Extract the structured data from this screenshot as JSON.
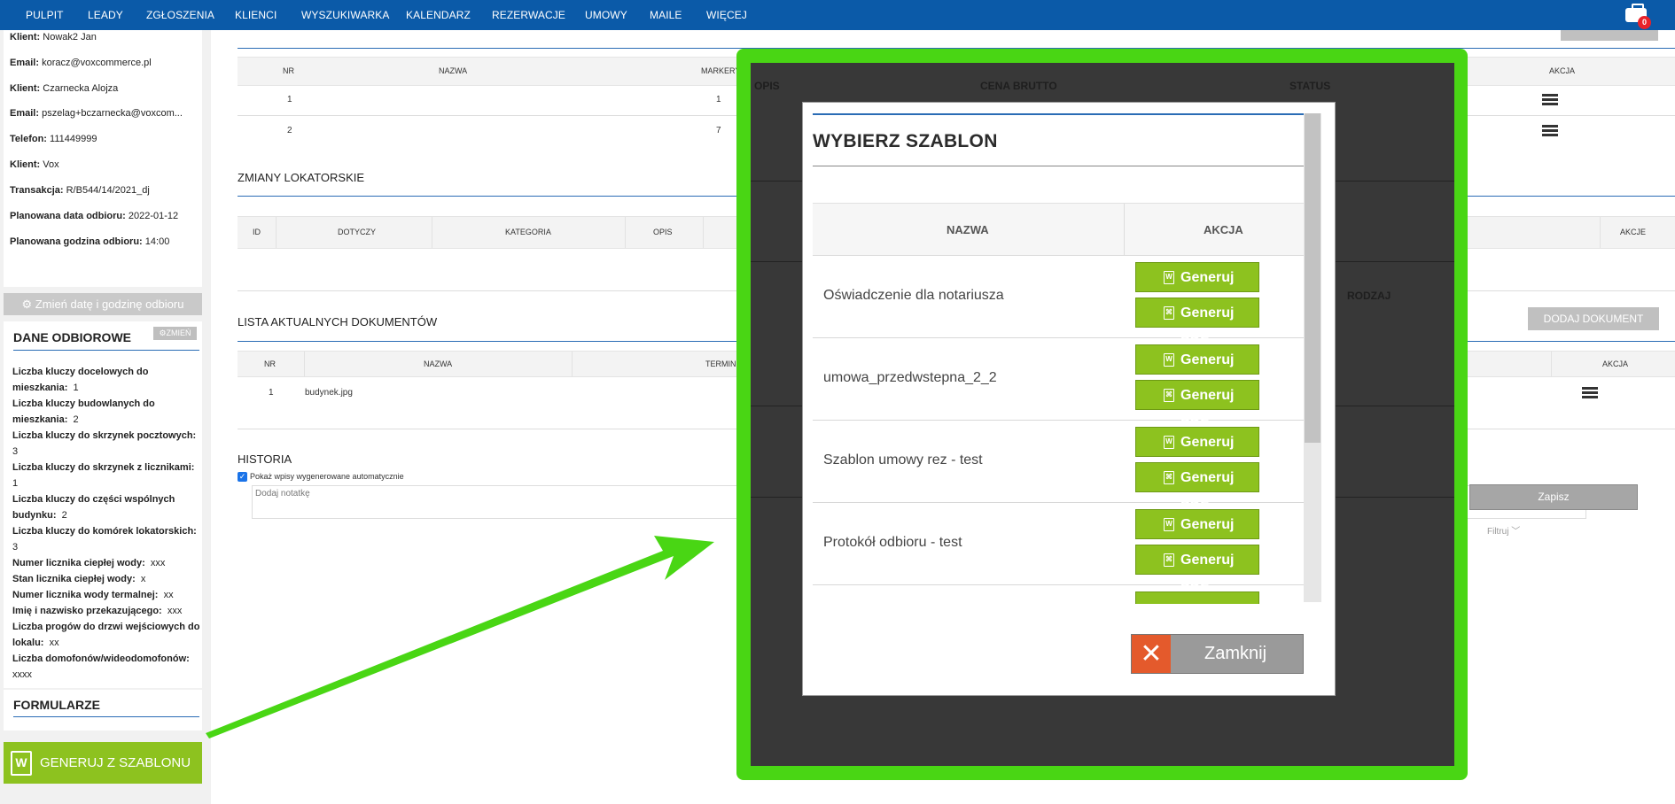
{
  "nav": {
    "items": [
      "PULPIT",
      "LEADY",
      "ZGŁOSZENIA",
      "KLIENCI",
      "WYSZUKIWARKA",
      "KALENDARZ",
      "REZERWACJE",
      "UMOWY",
      "MAILE",
      "WIĘCEJ"
    ],
    "badge": "0"
  },
  "client_info": [
    {
      "label": "Klient:",
      "value": "Nowak2 Jan"
    },
    {
      "label": "Email:",
      "value": "koracz@voxcommerce.pl"
    },
    {
      "label": "Klient:",
      "value": "Czarnecka Alojza"
    },
    {
      "label": "Email:",
      "value": "pszelag+bczarnecka@voxcom..."
    },
    {
      "label": "Telefon:",
      "value": "111449999"
    },
    {
      "label": "Klient:",
      "value": "Vox"
    },
    {
      "label": "Transakcja:",
      "value": "R/B544/14/2021_dj"
    },
    {
      "label": "Planowana data odbioru:",
      "value": "2022-01-12"
    },
    {
      "label": "Planowana godzina odbioru:",
      "value": "14:00"
    }
  ],
  "change_date_button": "Zmień datę i godzinę odbioru",
  "dane": {
    "title": "DANE ODBIOROWE",
    "edit": "ZMIEŃ",
    "rows": [
      {
        "label": "Liczba kluczy docelowych do mieszkania:",
        "value": "1"
      },
      {
        "label": "Liczba kluczy budowlanych do mieszkania:",
        "value": "2"
      },
      {
        "label": "Liczba kluczy do skrzynek pocztowych:",
        "value": "3"
      },
      {
        "label": "Liczba kluczy do skrzynek z licznikami:",
        "value": "1"
      },
      {
        "label": "Liczba kluczy do części wspólnych budynku:",
        "value": "2"
      },
      {
        "label": "Liczba kluczy do komórek lokatorskich:",
        "value": "3"
      },
      {
        "label": "Numer licznika ciepłej wody:",
        "value": "xxx"
      },
      {
        "label": "Stan licznika ciepłej wody:",
        "value": "x"
      },
      {
        "label": "Numer licznika wody termalnej:",
        "value": "xx"
      },
      {
        "label": "Imię i nazwisko przekazującego:",
        "value": "xxx"
      },
      {
        "label": "Liczba progów do drzwi wejściowych do lokalu:",
        "value": "xx"
      },
      {
        "label": "Liczba domofonów/wideodomofonów:",
        "value": "xxxx"
      }
    ]
  },
  "formularze_title": "FORMULARZE",
  "generate_button": "GENERUJ Z SZABLONU",
  "table1": {
    "headers": [
      "NR",
      "NAZWA",
      "MARKERY",
      "AKCJA"
    ],
    "rows": [
      {
        "nr": "1",
        "markery": "1"
      },
      {
        "nr": "2",
        "markery": "7"
      }
    ]
  },
  "zmiany": {
    "title": "ZMIANY LOKATORSKIE",
    "headers": [
      "ID",
      "DOTYCZY",
      "KATEGORIA",
      "OPIS",
      "AKCJE"
    ]
  },
  "dokumenty": {
    "title": "LISTA AKTUALNYCH DOKUMENTÓW",
    "add_button": "DODAJ DOKUMENT",
    "headers": [
      "NR",
      "NAZWA",
      "TERMIN",
      "AKCJA"
    ],
    "rows": [
      {
        "nr": "1",
        "nazwa": "budynek.jpg"
      }
    ]
  },
  "historia": {
    "title": "HISTORIA",
    "checkbox_label": "Pokaż wpisy wygenerowane automatycznie",
    "note_placeholder": "Dodaj notatkę",
    "save": "Zapisz",
    "filter": "Filtruj"
  },
  "background_dialog": {
    "headers": [
      "OPIS",
      "CENA BRUTTO",
      "STATUS"
    ],
    "rodzaj": "RODZAJ"
  },
  "modal": {
    "title": "WYBIERZ SZABLON",
    "col_name": "NAZWA",
    "col_action": "AKCJA",
    "templates": [
      {
        "name": "Oświadczenie dla notariusza",
        "doc": "Generuj DOC",
        "pdf": "Generuj PDF"
      },
      {
        "name": "umowa_przedwstepna_2_2",
        "doc": "Generuj DOC",
        "pdf": "Generuj PDF"
      },
      {
        "name": "Szablon umowy rez - test",
        "doc": "Generuj DOC",
        "pdf": "Generuj PDF"
      },
      {
        "name": "Protokół odbioru - test",
        "doc": "Generuj DOC",
        "pdf": "Generuj PDF"
      }
    ],
    "close": "Zamknij"
  },
  "colors": {
    "nav": "#0b5aa8",
    "accent_green": "#8dc21f",
    "highlight_frame": "#49d614",
    "close_icon": "#e45a2c"
  }
}
